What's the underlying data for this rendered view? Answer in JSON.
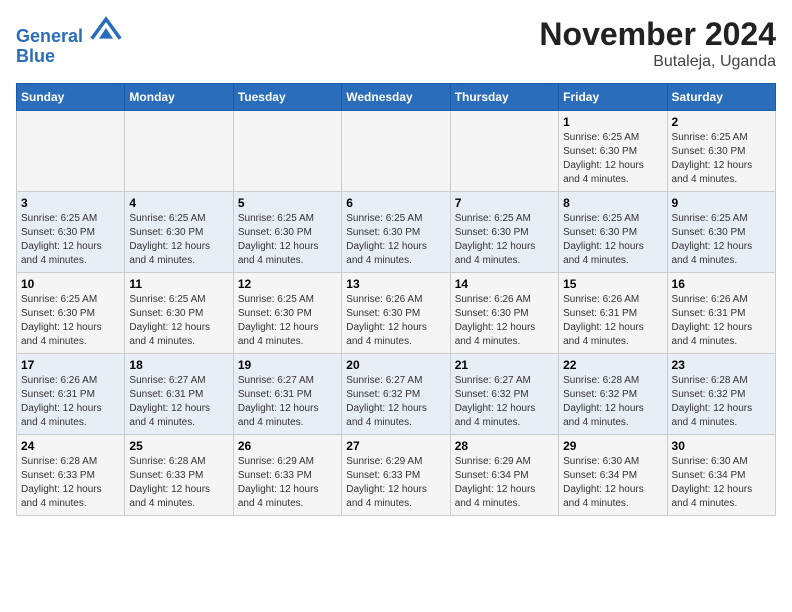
{
  "header": {
    "logo_line1": "General",
    "logo_line2": "Blue",
    "title": "November 2024",
    "subtitle": "Butaleja, Uganda"
  },
  "weekdays": [
    "Sunday",
    "Monday",
    "Tuesday",
    "Wednesday",
    "Thursday",
    "Friday",
    "Saturday"
  ],
  "weeks": [
    [
      {
        "day": "",
        "info": ""
      },
      {
        "day": "",
        "info": ""
      },
      {
        "day": "",
        "info": ""
      },
      {
        "day": "",
        "info": ""
      },
      {
        "day": "",
        "info": ""
      },
      {
        "day": "1",
        "info": "Sunrise: 6:25 AM\nSunset: 6:30 PM\nDaylight: 12 hours and 4 minutes."
      },
      {
        "day": "2",
        "info": "Sunrise: 6:25 AM\nSunset: 6:30 PM\nDaylight: 12 hours and 4 minutes."
      }
    ],
    [
      {
        "day": "3",
        "info": "Sunrise: 6:25 AM\nSunset: 6:30 PM\nDaylight: 12 hours and 4 minutes."
      },
      {
        "day": "4",
        "info": "Sunrise: 6:25 AM\nSunset: 6:30 PM\nDaylight: 12 hours and 4 minutes."
      },
      {
        "day": "5",
        "info": "Sunrise: 6:25 AM\nSunset: 6:30 PM\nDaylight: 12 hours and 4 minutes."
      },
      {
        "day": "6",
        "info": "Sunrise: 6:25 AM\nSunset: 6:30 PM\nDaylight: 12 hours and 4 minutes."
      },
      {
        "day": "7",
        "info": "Sunrise: 6:25 AM\nSunset: 6:30 PM\nDaylight: 12 hours and 4 minutes."
      },
      {
        "day": "8",
        "info": "Sunrise: 6:25 AM\nSunset: 6:30 PM\nDaylight: 12 hours and 4 minutes."
      },
      {
        "day": "9",
        "info": "Sunrise: 6:25 AM\nSunset: 6:30 PM\nDaylight: 12 hours and 4 minutes."
      }
    ],
    [
      {
        "day": "10",
        "info": "Sunrise: 6:25 AM\nSunset: 6:30 PM\nDaylight: 12 hours and 4 minutes."
      },
      {
        "day": "11",
        "info": "Sunrise: 6:25 AM\nSunset: 6:30 PM\nDaylight: 12 hours and 4 minutes."
      },
      {
        "day": "12",
        "info": "Sunrise: 6:25 AM\nSunset: 6:30 PM\nDaylight: 12 hours and 4 minutes."
      },
      {
        "day": "13",
        "info": "Sunrise: 6:26 AM\nSunset: 6:30 PM\nDaylight: 12 hours and 4 minutes."
      },
      {
        "day": "14",
        "info": "Sunrise: 6:26 AM\nSunset: 6:30 PM\nDaylight: 12 hours and 4 minutes."
      },
      {
        "day": "15",
        "info": "Sunrise: 6:26 AM\nSunset: 6:31 PM\nDaylight: 12 hours and 4 minutes."
      },
      {
        "day": "16",
        "info": "Sunrise: 6:26 AM\nSunset: 6:31 PM\nDaylight: 12 hours and 4 minutes."
      }
    ],
    [
      {
        "day": "17",
        "info": "Sunrise: 6:26 AM\nSunset: 6:31 PM\nDaylight: 12 hours and 4 minutes."
      },
      {
        "day": "18",
        "info": "Sunrise: 6:27 AM\nSunset: 6:31 PM\nDaylight: 12 hours and 4 minutes."
      },
      {
        "day": "19",
        "info": "Sunrise: 6:27 AM\nSunset: 6:31 PM\nDaylight: 12 hours and 4 minutes."
      },
      {
        "day": "20",
        "info": "Sunrise: 6:27 AM\nSunset: 6:32 PM\nDaylight: 12 hours and 4 minutes."
      },
      {
        "day": "21",
        "info": "Sunrise: 6:27 AM\nSunset: 6:32 PM\nDaylight: 12 hours and 4 minutes."
      },
      {
        "day": "22",
        "info": "Sunrise: 6:28 AM\nSunset: 6:32 PM\nDaylight: 12 hours and 4 minutes."
      },
      {
        "day": "23",
        "info": "Sunrise: 6:28 AM\nSunset: 6:32 PM\nDaylight: 12 hours and 4 minutes."
      }
    ],
    [
      {
        "day": "24",
        "info": "Sunrise: 6:28 AM\nSunset: 6:33 PM\nDaylight: 12 hours and 4 minutes."
      },
      {
        "day": "25",
        "info": "Sunrise: 6:28 AM\nSunset: 6:33 PM\nDaylight: 12 hours and 4 minutes."
      },
      {
        "day": "26",
        "info": "Sunrise: 6:29 AM\nSunset: 6:33 PM\nDaylight: 12 hours and 4 minutes."
      },
      {
        "day": "27",
        "info": "Sunrise: 6:29 AM\nSunset: 6:33 PM\nDaylight: 12 hours and 4 minutes."
      },
      {
        "day": "28",
        "info": "Sunrise: 6:29 AM\nSunset: 6:34 PM\nDaylight: 12 hours and 4 minutes."
      },
      {
        "day": "29",
        "info": "Sunrise: 6:30 AM\nSunset: 6:34 PM\nDaylight: 12 hours and 4 minutes."
      },
      {
        "day": "30",
        "info": "Sunrise: 6:30 AM\nSunset: 6:34 PM\nDaylight: 12 hours and 4 minutes."
      }
    ]
  ]
}
